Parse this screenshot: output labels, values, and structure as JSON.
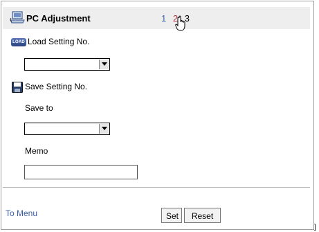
{
  "header": {
    "title": "PC Adjustment",
    "icon": "pc-adjustment-icon",
    "pages": [
      "1",
      "2",
      "3"
    ],
    "page_colors": {
      "1": "#3a64b5",
      "2": "#b0343f",
      "3": "#000000"
    }
  },
  "load": {
    "badge": "LOAD",
    "label": "Load Setting No.",
    "select_value": ""
  },
  "save": {
    "label": "Save Setting No.",
    "save_to_label": "Save to",
    "select_value": "",
    "memo_label": "Memo",
    "memo_value": ""
  },
  "footer": {
    "to_menu": "To Menu",
    "set_label": "Set",
    "reset_label": "Reset"
  }
}
